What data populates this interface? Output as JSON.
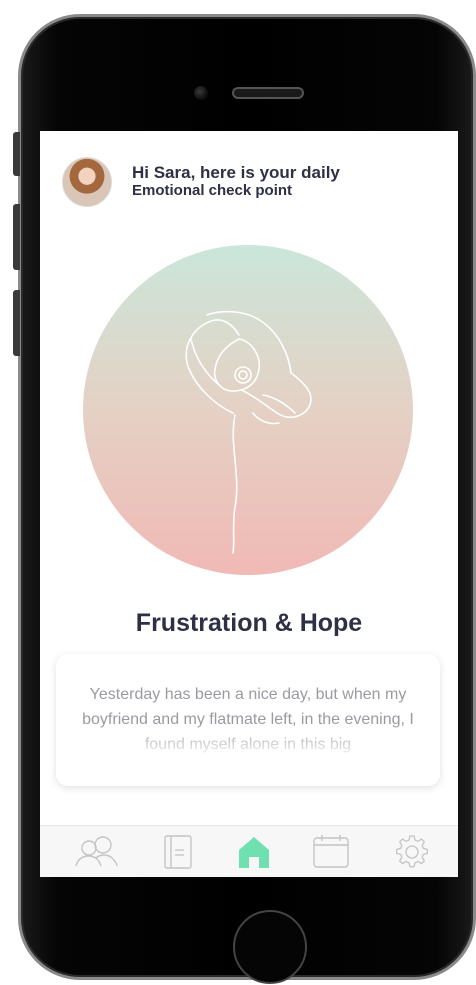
{
  "greeting": {
    "line1": "Hi Sara, here is your daily",
    "line2": "Emotional check point"
  },
  "mood": {
    "title": "Frustration & Hope",
    "illustration_icon": "poppy-flower-icon"
  },
  "note": {
    "text": "Yesterday has been a nice day, but when my boyfriend and my flatmate left, in the evening, I found myself alone in this big"
  },
  "tab_bar": {
    "items": [
      {
        "icon": "friends-icon",
        "active": false
      },
      {
        "icon": "journal-icon",
        "active": false
      },
      {
        "icon": "home-icon",
        "active": true
      },
      {
        "icon": "calendar-icon",
        "active": false
      },
      {
        "icon": "settings-gear-icon",
        "active": false
      }
    ],
    "active_color": "#6fe0b0",
    "inactive_color": "#c4c4c4"
  },
  "colors": {
    "gradient_top": "#cbe6da",
    "gradient_bottom": "#f1b9b6",
    "title_text": "#2f2f45"
  }
}
